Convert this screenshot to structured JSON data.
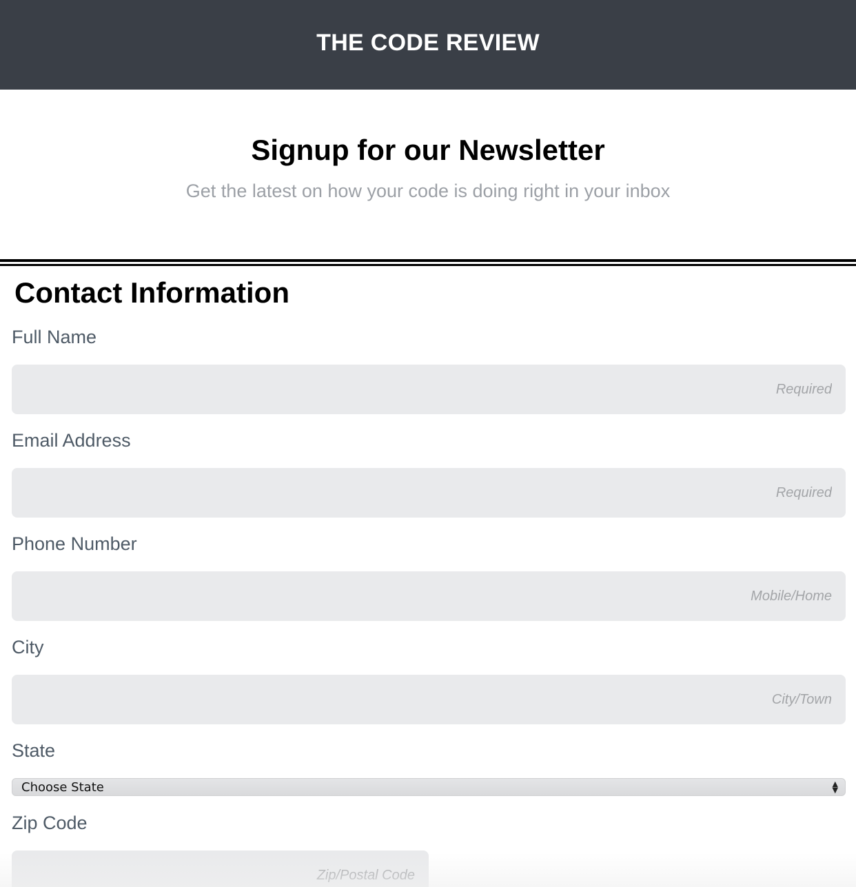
{
  "header": {
    "brand": "THE CODE REVIEW"
  },
  "hero": {
    "title": "Signup for our Newsletter",
    "subtitle": "Get the latest on how your code is doing right in your inbox"
  },
  "form": {
    "section_title": "Contact Information",
    "fields": {
      "full_name": {
        "label": "Full Name",
        "placeholder": "Required",
        "value": ""
      },
      "email": {
        "label": "Email Address",
        "placeholder": "Required",
        "value": ""
      },
      "phone": {
        "label": "Phone Number",
        "placeholder": "Mobile/Home",
        "value": ""
      },
      "city": {
        "label": "City",
        "placeholder": "City/Town",
        "value": ""
      },
      "state": {
        "label": "State",
        "selected": "Choose State"
      },
      "zip": {
        "label": "Zip Code",
        "placeholder": "Zip/Postal Code",
        "value": ""
      }
    }
  }
}
